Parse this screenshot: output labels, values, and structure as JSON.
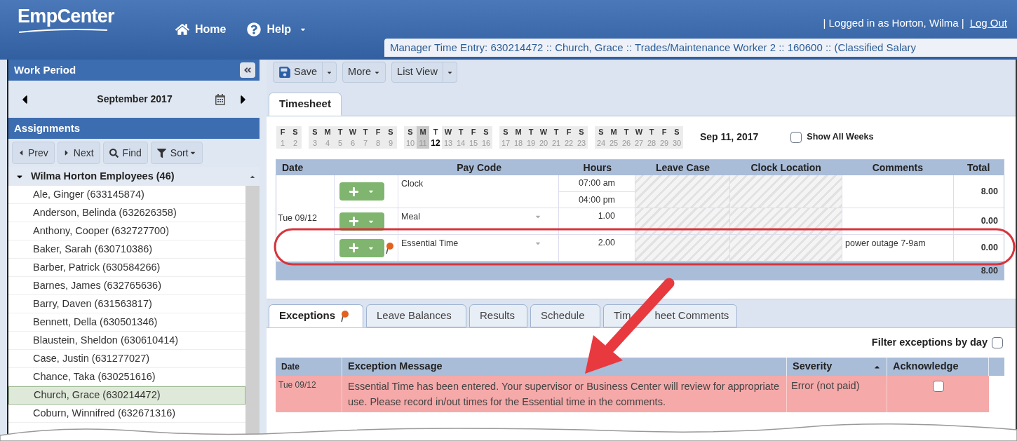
{
  "header": {
    "logo": "EmpCenter",
    "nav": [
      {
        "label": "Home",
        "kind": "home"
      },
      {
        "label": "Help",
        "kind": "help"
      }
    ],
    "logged_in": "| Logged in as Horton, Wilma |",
    "logout": "Log Out",
    "page_title": "Manager Time Entry: 630214472 :: Church, Grace :: Trades/Maintenance Worker 2 :: 160600 :: (Classified Salary"
  },
  "sidebar": {
    "work_period": {
      "title": "Work Period",
      "month": "September 2017"
    },
    "assignments": {
      "title": "Assignments",
      "buttons": [
        {
          "label": "Prev",
          "kind": "prev"
        },
        {
          "label": "Next",
          "kind": "next"
        },
        {
          "label": "Find",
          "kind": "find"
        },
        {
          "label": "Sort",
          "kind": "sort"
        }
      ],
      "group": {
        "label": "Wilma Horton Employees (46)",
        "expanded": true,
        "children": [
          {
            "label": "Ale, Ginger (633145874)",
            "selected": false
          },
          {
            "label": "Anderson, Belinda (632626358)",
            "selected": false
          },
          {
            "label": "Anthony, Cooper (632727700)",
            "selected": false
          },
          {
            "label": "Baker, Sarah (630710386)",
            "selected": false
          },
          {
            "label": "Barber, Patrick (630584266)",
            "selected": false
          },
          {
            "label": "Barnes, James (632765636)",
            "selected": false
          },
          {
            "label": "Barry, Daven (631563817)",
            "selected": false
          },
          {
            "label": "Bennett, Della (630501346)",
            "selected": false
          },
          {
            "label": "Blaustein, Sheldon (630610414)",
            "selected": false
          },
          {
            "label": "Case, Justin (631277027)",
            "selected": false
          },
          {
            "label": "Chance, Taka (630251616)",
            "selected": false
          },
          {
            "label": "Church, Grace (630214472)",
            "selected": true
          },
          {
            "label": "Coburn, Winnifred (632671316)",
            "selected": false
          }
        ]
      }
    }
  },
  "toolbar": {
    "buttons": [
      {
        "label": "Save",
        "kind": "save"
      },
      {
        "label": "More",
        "kind": "menu"
      },
      {
        "label": "List View",
        "kind": "split"
      }
    ]
  },
  "tabs": [
    {
      "label": "Timesheet",
      "selected": true
    }
  ],
  "calendar": {
    "weeks": [
      [
        {
          "letter": "F",
          "date": "1",
          "selected": false,
          "current": false
        },
        {
          "letter": "S",
          "date": "2",
          "selected": false,
          "current": false
        }
      ],
      [
        {
          "letter": "S",
          "date": "3",
          "selected": false,
          "current": false
        },
        {
          "letter": "M",
          "date": "4",
          "selected": false,
          "current": false
        },
        {
          "letter": "T",
          "date": "5",
          "selected": false,
          "current": false
        },
        {
          "letter": "W",
          "date": "6",
          "selected": false,
          "current": false
        },
        {
          "letter": "T",
          "date": "7",
          "selected": false,
          "current": false
        },
        {
          "letter": "F",
          "date": "8",
          "selected": false,
          "current": false
        },
        {
          "letter": "S",
          "date": "9",
          "selected": false,
          "current": false
        }
      ],
      [
        {
          "letter": "S",
          "date": "10",
          "selected": false,
          "current": false
        },
        {
          "letter": "M",
          "date": "11",
          "selected": false,
          "current": true
        },
        {
          "letter": "T",
          "date": "12",
          "selected": true,
          "current": false
        },
        {
          "letter": "W",
          "date": "13",
          "selected": false,
          "current": false
        },
        {
          "letter": "T",
          "date": "14",
          "selected": false,
          "current": false
        },
        {
          "letter": "F",
          "date": "15",
          "selected": false,
          "current": false
        },
        {
          "letter": "S",
          "date": "16",
          "selected": false,
          "current": false
        }
      ],
      [
        {
          "letter": "S",
          "date": "17",
          "selected": false,
          "current": false
        },
        {
          "letter": "M",
          "date": "18",
          "selected": false,
          "current": false
        },
        {
          "letter": "T",
          "date": "19",
          "selected": false,
          "current": false
        },
        {
          "letter": "W",
          "date": "20",
          "selected": false,
          "current": false
        },
        {
          "letter": "T",
          "date": "21",
          "selected": false,
          "current": false
        },
        {
          "letter": "F",
          "date": "22",
          "selected": false,
          "current": false
        },
        {
          "letter": "S",
          "date": "23",
          "selected": false,
          "current": false
        }
      ],
      [
        {
          "letter": "S",
          "date": "24",
          "selected": false,
          "current": false
        },
        {
          "letter": "M",
          "date": "25",
          "selected": false,
          "current": false
        },
        {
          "letter": "T",
          "date": "26",
          "selected": false,
          "current": false
        },
        {
          "letter": "W",
          "date": "27",
          "selected": false,
          "current": false
        },
        {
          "letter": "T",
          "date": "28",
          "selected": false,
          "current": false
        },
        {
          "letter": "F",
          "date": "29",
          "selected": false,
          "current": false
        },
        {
          "letter": "S",
          "date": "30",
          "selected": false,
          "current": false
        }
      ]
    ],
    "date": "Sep 11, 2017",
    "show_all_weeks": {
      "label": "Show All Weeks",
      "checked": false
    }
  },
  "timesheet": {
    "columns": [
      "Date",
      "Pay Code",
      "Hours",
      "Leave Case",
      "Clock Location",
      "Comments",
      "Total"
    ],
    "date": "Tue 09/12",
    "entries": [
      {
        "pay_code": "Clock",
        "dropdown": false,
        "hours": [
          "07:00 am",
          "04:00 pm"
        ],
        "total": "8.00",
        "exception": false
      },
      {
        "pay_code": "Meal",
        "dropdown": true,
        "hours": [
          "1.00"
        ],
        "total": "0.00",
        "exception": false
      },
      {
        "pay_code": "Essential Time",
        "dropdown": true,
        "hours": [
          "2.00"
        ],
        "comment": "power outage 7-9am",
        "total": "0.00",
        "exception": true
      }
    ],
    "footer_total": "8.00"
  },
  "bottom_tabs": [
    {
      "label": "Exceptions",
      "selected": true,
      "flagged": true
    },
    {
      "label": "Leave Balances",
      "selected": false
    },
    {
      "label": "Results",
      "selected": false
    },
    {
      "label": "Schedule",
      "selected": false
    },
    {
      "label_parts": [
        "Tim",
        "heet Comments"
      ],
      "selected": false
    }
  ],
  "exceptions": {
    "filter": {
      "label": "Filter exceptions by day",
      "checked": false
    },
    "columns": [
      {
        "label": "Date",
        "sorted": false
      },
      {
        "label": "Exception Message",
        "sorted": false
      },
      {
        "label": "Severity",
        "sorted": true
      },
      {
        "label": "Acknowledge",
        "sorted": false
      }
    ],
    "rows": [
      {
        "date": "Tue 09/12",
        "message": "Essential Time has been entered. Your supervisor or Business Center will review for appropriate use. Please record in/out times for the Essential time in the comments.",
        "severity": "Error (not paid)",
        "acknowledged": false
      }
    ]
  }
}
